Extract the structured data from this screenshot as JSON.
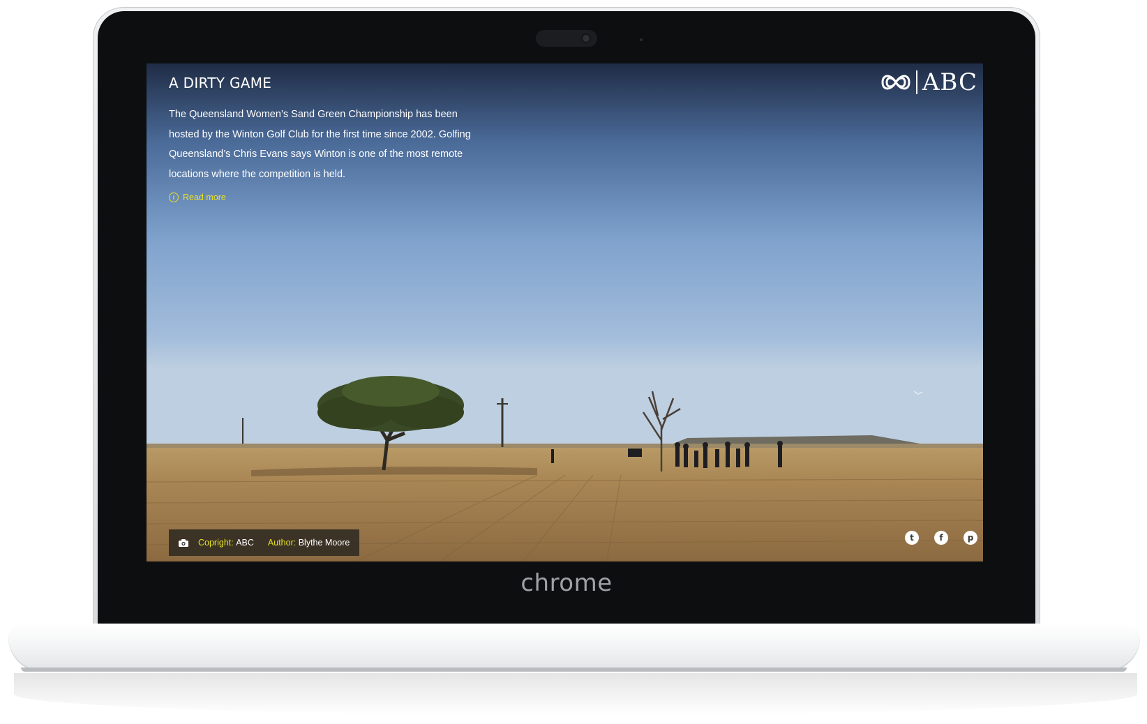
{
  "device": {
    "brand_label": "chrome"
  },
  "story": {
    "title": "A DIRTY GAME",
    "body": "The Queensland Women’s Sand Green Championship has been hosted by the Winton Golf Club for the first time since 2002. Golfing Queensland’s Chris Evans says Winton is one of the most remote locations where the competition is held.",
    "read_more": "Read more"
  },
  "logo": {
    "text": "ABC"
  },
  "credits": {
    "copyright_label": "Copright:",
    "copyright_value": "ABC",
    "author_label": "Author:",
    "author_value": "Blythe Moore"
  },
  "share": {
    "twitter_glyph": "t",
    "facebook_glyph": "f",
    "pinterest_glyph": "p"
  },
  "colors": {
    "accent_yellow": "#e6e02a",
    "bezel": "#0d0e10"
  },
  "icons": {
    "info": "info-icon",
    "camera": "camera-icon",
    "twitter": "twitter-icon",
    "facebook": "facebook-icon",
    "pinterest": "pinterest-icon"
  }
}
